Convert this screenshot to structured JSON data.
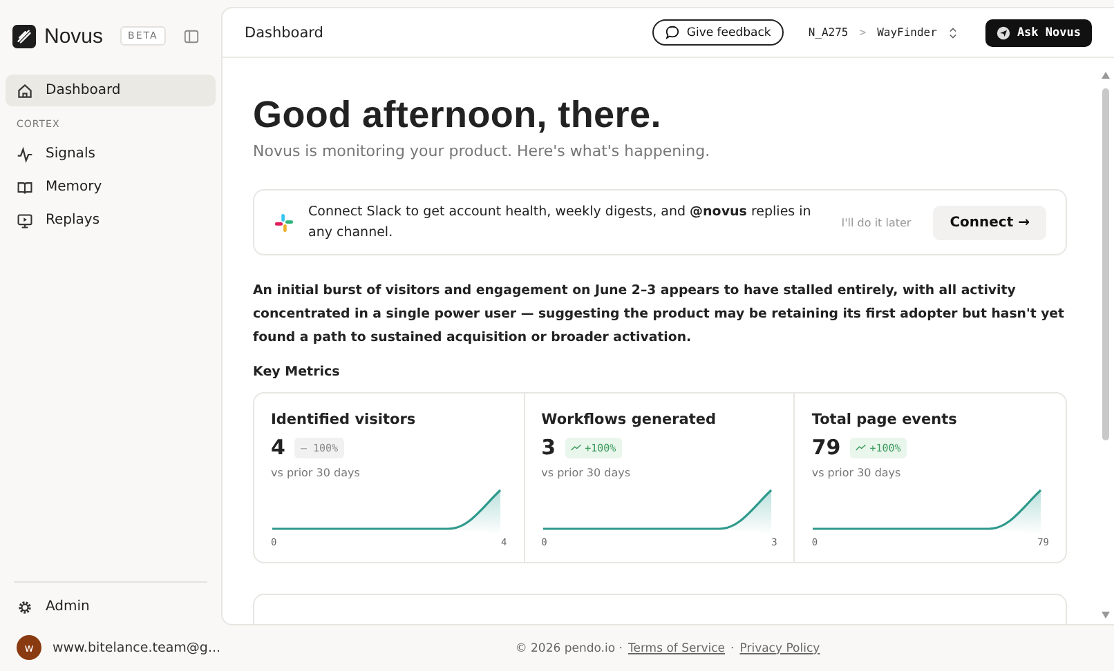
{
  "sidebar": {
    "brand": "Novus",
    "badge": "BETA",
    "items": [
      {
        "label": "Dashboard",
        "kind": "home",
        "selected": true
      }
    ],
    "section": "CORTEX",
    "section_items": [
      {
        "label": "Signals",
        "kind": "pulse",
        "selected": false
      },
      {
        "label": "Memory",
        "kind": "book",
        "selected": false
      },
      {
        "label": "Replays",
        "kind": "replay",
        "selected": false
      }
    ],
    "admin": "Admin",
    "user": {
      "initial": "w",
      "email": "www.bitelance.team@g..."
    }
  },
  "header": {
    "title": "Dashboard",
    "feedback": "Give feedback",
    "org": "N_A275",
    "separator": ">",
    "project": "WayFinder",
    "ask": "Ask Novus"
  },
  "greeting": "Good afternoon, there.",
  "subtitle": "Novus is monitoring your product. Here's what's happening.",
  "slack": {
    "text": "Connect Slack to get account health, weekly digests, and **@novus** replies in any channel.",
    "later": "I'll do it later",
    "connect": "Connect →"
  },
  "summary": "An initial burst of visitors and engagement on June 2–3 appears to have stalled entirely, with all activity concentrated in a single power user — suggesting the product may be retaining its first adopter but hasn't yet found a path to sustained acquisition or broader activation.",
  "metrics_title": "Key Metrics",
  "metrics": [
    {
      "label": "Identified visitors",
      "value": "4",
      "kind": "flat",
      "change": "— 100%",
      "note": "vs prior 30 days",
      "min": "0",
      "max": "4"
    },
    {
      "label": "Workflows generated",
      "value": "3",
      "kind": "up",
      "change": "+100%",
      "note": "vs prior 30 days",
      "min": "0",
      "max": "3"
    },
    {
      "label": "Total page events",
      "value": "79",
      "kind": "up",
      "change": "+100%",
      "note": "vs prior 30 days",
      "min": "0",
      "max": "79"
    }
  ],
  "footer": {
    "copyright": "© 2026 pendo.io ·",
    "terms": "Terms of Service",
    "dot": "·",
    "privacy": "Privacy Policy"
  }
}
